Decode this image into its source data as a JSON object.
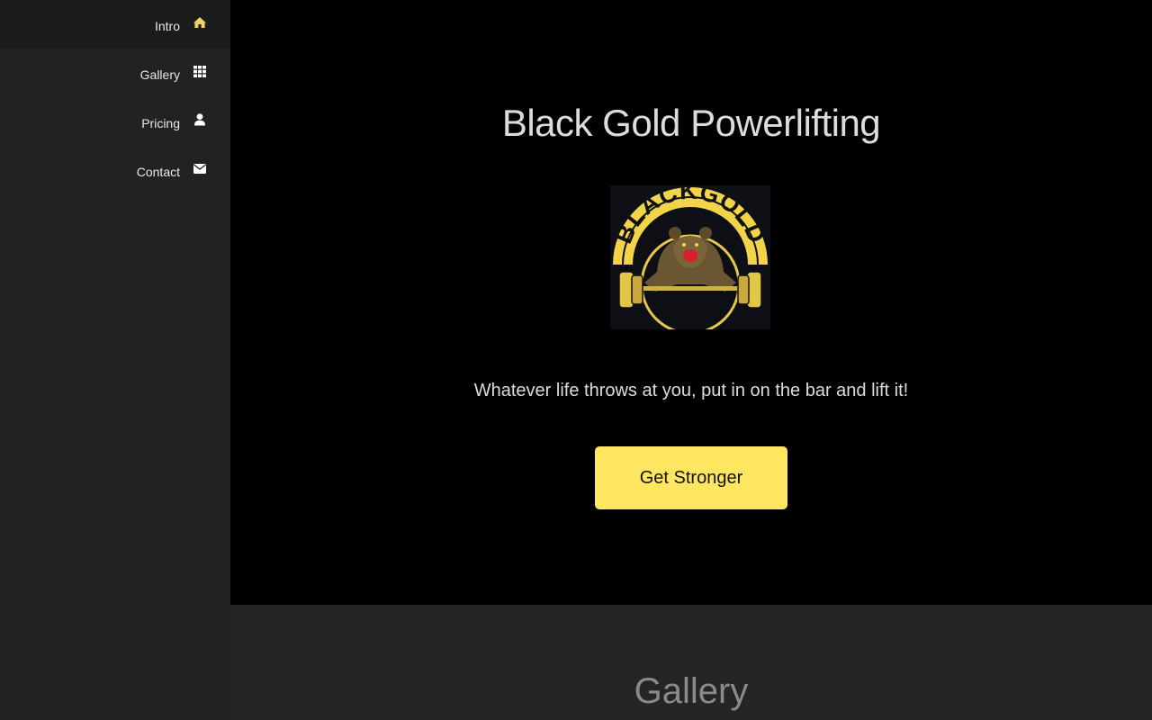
{
  "sidebar": {
    "items": [
      {
        "label": "Intro",
        "icon": "home-icon",
        "active": true
      },
      {
        "label": "Gallery",
        "icon": "grid-icon",
        "active": false
      },
      {
        "label": "Pricing",
        "icon": "user-icon",
        "active": false
      },
      {
        "label": "Contact",
        "icon": "envelope-icon",
        "active": false
      }
    ]
  },
  "intro": {
    "title": "Black Gold Powerlifting",
    "logo_text": "BLACKGOLD",
    "tagline": "Whatever life throws at you, put in on the bar and lift it!",
    "cta_label": "Get Stronger"
  },
  "gallery": {
    "title": "Gallery"
  },
  "colors": {
    "accent": "#ffe660",
    "sidebar_bg": "#222222",
    "active_icon": "#f2d16b",
    "main_bg": "#000000",
    "gallery_bg": "#252525"
  }
}
